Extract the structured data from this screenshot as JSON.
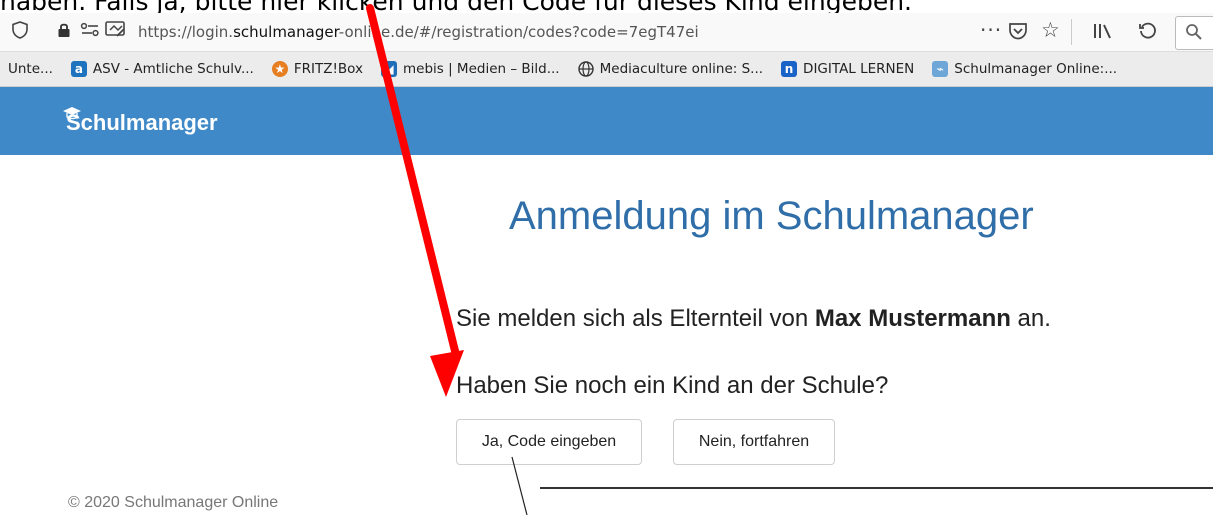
{
  "caption": "haben. Falls ja, bitte hier klicken und den Code für dieses Kind eingeben.",
  "browser": {
    "url_plain_prefix": "https://login.",
    "url_domain": "schulmanager",
    "url_rest": "-online.de/#/registration/codes?code=7egT47ei",
    "bookmarks": [
      {
        "label": "Unte...",
        "icon": "bookmark-icon"
      },
      {
        "label": "ASV - Amtliche Schulv...",
        "icon": "a-icon",
        "color": "#1e73be"
      },
      {
        "label": "FRITZ!Box",
        "icon": "fritz-icon",
        "color": "#e67e22"
      },
      {
        "label": "mebis | Medien – Bild...",
        "icon": "mebis-icon",
        "color": "#1f6fb8"
      },
      {
        "label": "Mediaculture online: S...",
        "icon": "globe-icon"
      },
      {
        "label": "DIGITAL LERNEN",
        "icon": "n-icon",
        "color": "#1a64c8"
      },
      {
        "label": "Schulmanager Online:...",
        "icon": "schulmanager-icon",
        "color": "#6ea6d8"
      }
    ]
  },
  "app": {
    "brand": "Schulmanager",
    "title": "Anmeldung im Schulmanager",
    "line1_prefix": "Sie melden sich als Elternteil von ",
    "child_name": "Max Mustermann",
    "line1_suffix": " an.",
    "line2": "Haben Sie noch ein Kind an der Schule?",
    "btn_yes": "Ja, Code eingeben",
    "btn_no": "Nein, fortfahren",
    "footer": "© 2020 Schulmanager Online"
  },
  "colors": {
    "appbar": "#3f89c8",
    "title": "#2f6ea8",
    "arrow": "#ff0000"
  }
}
